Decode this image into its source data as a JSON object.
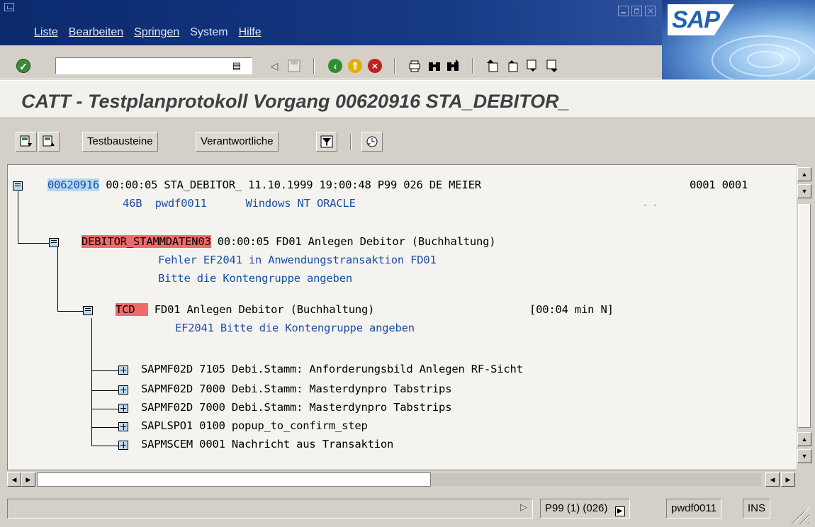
{
  "menubar": {
    "items": [
      {
        "label": "Liste"
      },
      {
        "label": "Bearbeiten"
      },
      {
        "label": "Springen"
      },
      {
        "label": "System"
      },
      {
        "label": "Hilfe"
      }
    ],
    "logo_text": "SAP"
  },
  "toolbar": {
    "command_field_value": "",
    "icons": [
      "enter-check-icon",
      "command-dropdown-icon",
      "back-arrow-icon",
      "save-disk-icon",
      "back-green-icon",
      "exit-yellow-icon",
      "cancel-red-icon",
      "print-icon",
      "find-icon",
      "find-next-icon",
      "first-page-icon",
      "previous-page-icon",
      "next-page-icon",
      "last-page-icon"
    ]
  },
  "title": "CATT - Testplanprotokoll  Vorgang 00620916 STA_DEBITOR_",
  "apptoolbar": {
    "buttons": [
      {
        "label": "Testbausteine"
      },
      {
        "label": "Verantwortliche"
      }
    ]
  },
  "tree": {
    "root": {
      "id": "00620916",
      "line1_rest": " 00:00:05 STA_DEBITOR_ 11.10.1999 19:00:48 P99 026 DE MEIER",
      "counters": "0001 0001",
      "line2": "46B  pwdf0011      Windows NT ORACLE"
    },
    "module": {
      "name": "DEBITOR_STAMMDATEN03",
      "rest": " 00:00:05 FD01 Anlegen Debitor (Buchhaltung)",
      "error1": "Fehler EF2041 in Anwendungstransaktion FD01",
      "error2": "Bitte die Kontengruppe angeben"
    },
    "tcd": {
      "tag": "TCD  ",
      "text": " FD01 Anlegen Debitor (Buchhaltung)",
      "duration": "[00:04 min N]",
      "message": "EF2041 Bitte die Kontengruppe angeben"
    },
    "screens": [
      {
        "text": "SAPMF02D 7105 Debi.Stamm: Anforderungsbild Anlegen RF-Sicht"
      },
      {
        "text": "SAPMF02D 7000 Debi.Stamm: Masterdynpro Tabstrips"
      },
      {
        "text": "SAPMF02D 7000 Debi.Stamm: Masterdynpro Tabstrips"
      },
      {
        "text": "SAPLSPO1 0100 popup_to_confirm_step"
      },
      {
        "text": "SAPMSCEM 0001 Nachricht aus Transaktion"
      }
    ]
  },
  "statusbar": {
    "system": "P99 (1) (026)",
    "server": "pwdf0011",
    "mode": "INS"
  },
  "colors": {
    "menubar": "#173a85",
    "highlight_blue": "#b8d8f0",
    "error_red": "#f06a6a",
    "text_blue": "#1a4fa3"
  }
}
